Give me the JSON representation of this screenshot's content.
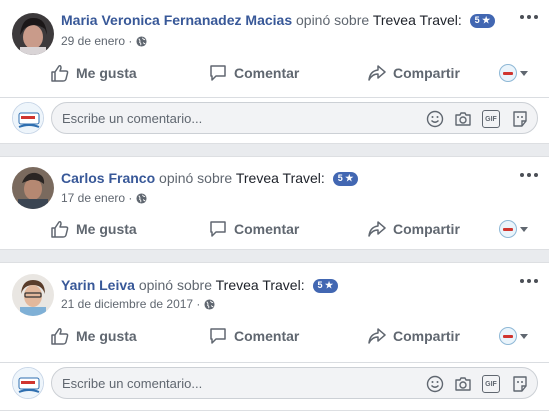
{
  "actions": {
    "like": "Me gusta",
    "comment": "Comentar",
    "share": "Compartir"
  },
  "comment_placeholder": "Escribe un comentario...",
  "reviews": [
    {
      "name": "Maria Veronica Fernanadez Macias",
      "verb": "opinó sobre",
      "page": "Trevea Travel:",
      "rating": "5 ★",
      "date": "29 de enero ·"
    },
    {
      "name": "Carlos Franco",
      "verb": "opinó sobre",
      "page": "Trevea Travel:",
      "rating": "5 ★",
      "date": "17 de enero ·"
    },
    {
      "name": "Yarin Leiva",
      "verb": "opinó sobre",
      "page": "Trevea Travel:",
      "rating": "5 ★",
      "date": "21 de diciembre de 2017 ·"
    }
  ],
  "colors": {
    "link": "#385898",
    "muted": "#606770",
    "rating_badge": "#4267b2",
    "background": "#e9ebee"
  }
}
